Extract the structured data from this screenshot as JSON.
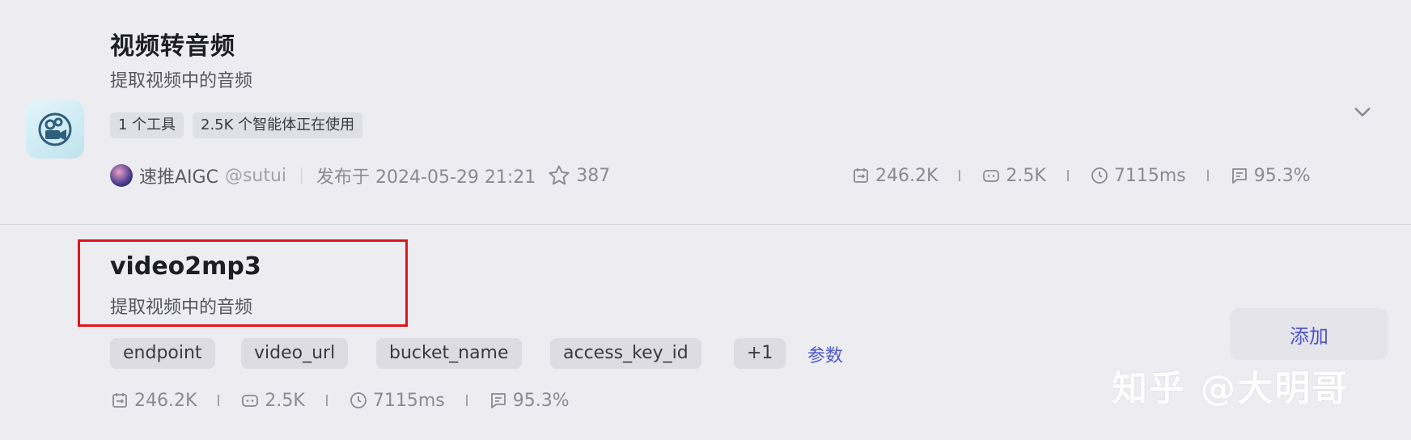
{
  "plugin": {
    "title": "视频转音频",
    "description": "提取视频中的音频",
    "tags": [
      "1 个工具",
      "2.5K 个智能体正在使用"
    ],
    "author": {
      "name": "速推AIGC",
      "handle": "@sutui"
    },
    "published": "发布于 2024-05-29 21:21",
    "stars": "387",
    "stats": {
      "calls": "246.2K",
      "bots": "2.5K",
      "latency": "7115ms",
      "success": "95.3%"
    }
  },
  "tool": {
    "name": "video2mp3",
    "description": "提取视频中的音频",
    "params": [
      "endpoint",
      "video_url",
      "bucket_name",
      "access_key_id",
      "+1"
    ],
    "params_link": "参数",
    "add_label": "添加",
    "stats": {
      "calls": "246.2K",
      "bots": "2.5K",
      "latency": "7115ms",
      "success": "95.3%"
    }
  },
  "watermark": "知乎 @大明哥",
  "colors": {
    "accent": "#4f56c8",
    "highlight": "#e0141b",
    "background": "#ececf1"
  },
  "icons": {
    "calls": "calendar-loop-icon",
    "bots": "bot-icon",
    "latency": "clock-icon",
    "success": "report-icon",
    "expand": "chevron-down-icon",
    "star": "star-icon"
  }
}
